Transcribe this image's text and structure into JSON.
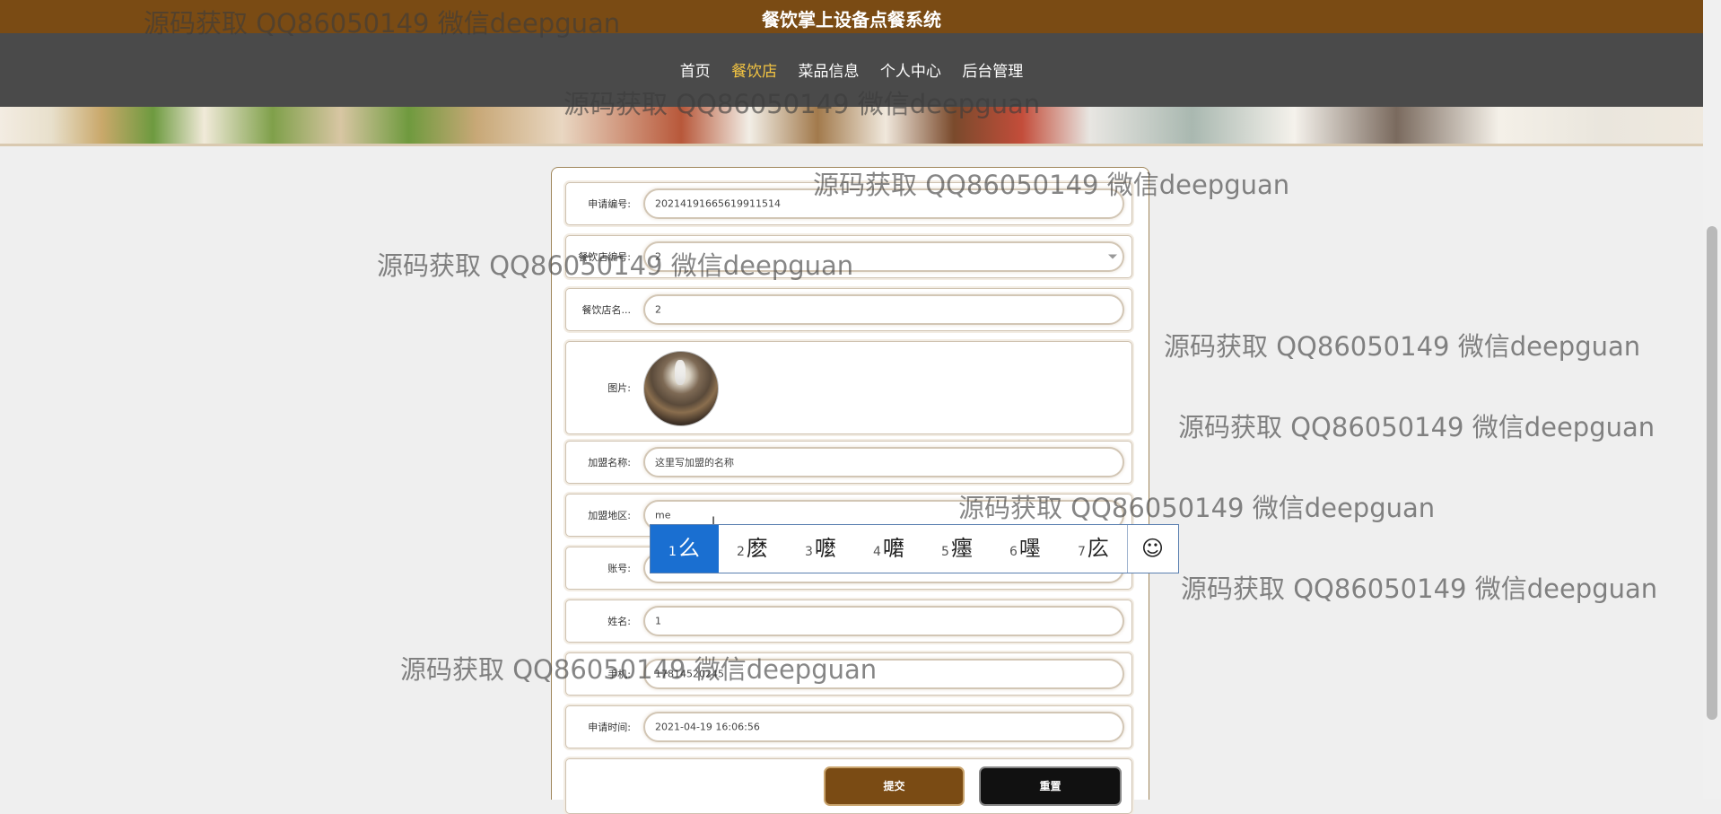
{
  "header": {
    "title": "餐饮掌上设备点餐系统",
    "nav": [
      {
        "label": "首页",
        "active": false
      },
      {
        "label": "餐饮店",
        "active": true
      },
      {
        "label": "菜品信息",
        "active": false
      },
      {
        "label": "个人中心",
        "active": false
      },
      {
        "label": "后台管理",
        "active": false
      }
    ]
  },
  "form": {
    "fields": [
      {
        "label": "申请编号:",
        "value": "20214191665619911514"
      },
      {
        "label": "餐饮店编号:",
        "value": "2"
      },
      {
        "label": "餐饮店名...",
        "value": "2"
      },
      {
        "label": "图片:",
        "value": ""
      },
      {
        "label": "加盟名称:",
        "value": "这里写加盟的名称"
      },
      {
        "label": "加盟地区:",
        "value": "me"
      },
      {
        "label": "账号:",
        "value": ""
      },
      {
        "label": "姓名:",
        "value": "1"
      },
      {
        "label": "手机:",
        "value": "17814520245"
      },
      {
        "label": "申请时间:",
        "value": "2021-04-19 16:06:56"
      }
    ],
    "submit_label": "提交",
    "reset_label": "重置"
  },
  "ime": {
    "candidates": [
      {
        "num": "1",
        "char": "么"
      },
      {
        "num": "2",
        "char": "麽"
      },
      {
        "num": "3",
        "char": "嚒"
      },
      {
        "num": "4",
        "char": "嚰"
      },
      {
        "num": "5",
        "char": "癦"
      },
      {
        "num": "6",
        "char": "嚜"
      },
      {
        "num": "7",
        "char": "庅"
      }
    ],
    "emoji": "☺"
  },
  "watermark": "源码获取 QQ86050149 微信deepguan",
  "colors": {
    "brand": "#7a4b14",
    "nav_bg": "#4a4a4a",
    "nav_active": "#f4c542",
    "ime_selected": "#1a6fd1"
  }
}
